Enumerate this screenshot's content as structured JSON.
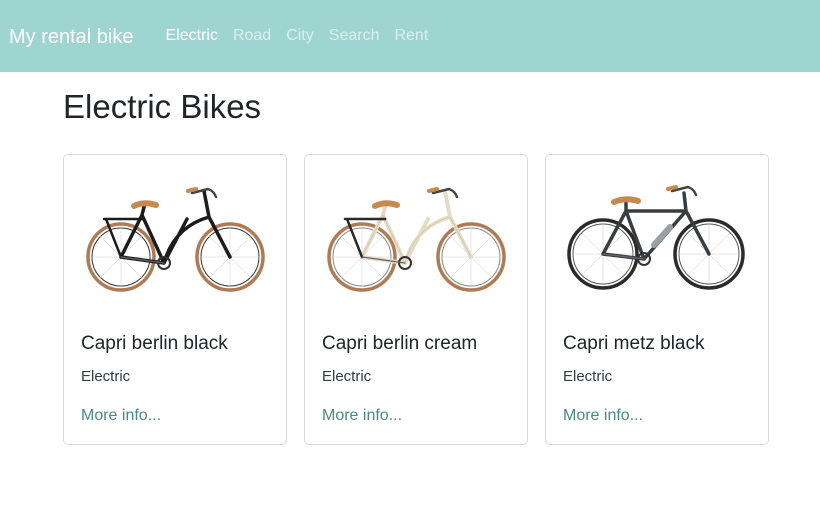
{
  "navbar": {
    "brand": "My rental bike",
    "links": [
      {
        "label": "Electric",
        "active": true
      },
      {
        "label": "Road",
        "active": false
      },
      {
        "label": "City",
        "active": false
      },
      {
        "label": "Search",
        "active": false
      },
      {
        "label": "Rent",
        "active": false
      }
    ],
    "background": "#9fd5d1"
  },
  "main": {
    "title": "Electric Bikes",
    "cards": [
      {
        "title": "Capri berlin black",
        "category": "Electric",
        "link_label": "More info...",
        "image": "bike-photo-step-through-black",
        "frame_color": "#1c1c1c",
        "tire_color": "#b07a52"
      },
      {
        "title": "Capri berlin cream",
        "category": "Electric",
        "link_label": "More info...",
        "image": "bike-photo-step-through-cream",
        "frame_color": "#efe8d6",
        "tire_color": "#b07a52"
      },
      {
        "title": "Capri metz black",
        "category": "Electric",
        "link_label": "More info...",
        "image": "bike-photo-diamond-frame-black",
        "frame_color": "#3a3d40",
        "tire_color": "#2b2b2b"
      }
    ]
  }
}
